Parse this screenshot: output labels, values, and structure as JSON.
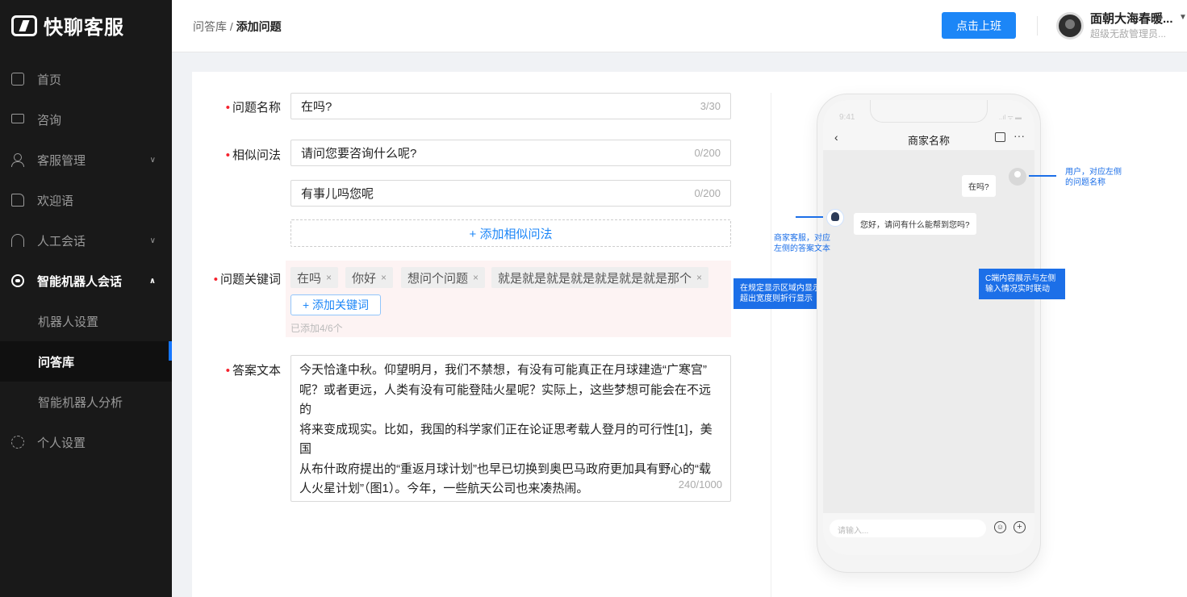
{
  "app": {
    "name": "快聊客服"
  },
  "sidebar": {
    "items": [
      {
        "label": "首页",
        "icon": "home-icon"
      },
      {
        "label": "咨询",
        "icon": "chat-icon"
      },
      {
        "label": "客服管理",
        "icon": "user-group-icon",
        "expandable": true
      },
      {
        "label": "欢迎语",
        "icon": "hand-icon"
      },
      {
        "label": "人工会话",
        "icon": "headset-icon",
        "expandable": true
      },
      {
        "label": "智能机器人会话",
        "icon": "robot-icon",
        "expanded": true
      },
      {
        "label": "个人设置",
        "icon": "gear-icon"
      }
    ],
    "subitems": [
      "机器人设置",
      "问答库",
      "智能机器人分析"
    ],
    "active_sub": "问答库",
    "accent": "#1677ff"
  },
  "header": {
    "breadcrumb_parent": "问答库",
    "breadcrumb_sep": " / ",
    "breadcrumb_current": "添加问题",
    "onduty_label": "点击上班",
    "user_name": "面朝大海春暖...",
    "user_role": "超级无敌管理员..."
  },
  "form": {
    "req_mark": "•",
    "question_label": "问题名称",
    "question_value": "在吗?",
    "question_count": "3/30",
    "similar_label": "相似问法",
    "similar": [
      {
        "value": "请问您要咨询什么呢?",
        "count": "0/200"
      },
      {
        "value": "有事儿吗您呢",
        "count": "0/200"
      }
    ],
    "add_similar": "+ 添加相似问法",
    "keywords_label": "问题关键词",
    "keywords": [
      "在吗",
      "你好",
      "想问个问题",
      "就是就是就是就是就是就是就是那个"
    ],
    "tag_close": "×",
    "add_keyword": "+ 添加关键词",
    "keyword_count": "已添加4/6个",
    "answer_label": "答案文本",
    "answer_lines": [
      "今天恰逢中秋。仰望明月，我们不禁想，有没有可能真正在月球建造“广寒宫”",
      "呢？或者更远，人类有没有可能登陆火星呢？实际上，这些梦想可能会在不远的",
      "将来变成现实。比如，我国的科学家们正在论证思考载人登月的可行性[1]，美国",
      "从布什政府提出的“重返月球计划”也早已切换到奥巴马政府更加具有野心的“载",
      "人火星计划”（图1）。今年，一些航天公司也来凑热闹。"
    ],
    "answer_count": "240/1000"
  },
  "annotations": {
    "keyword_note": [
      "在规定显示区域内显示，",
      "超出宽度则折行显示"
    ],
    "bot_note": [
      "商家客服，对应",
      "左侧的答案文本"
    ],
    "user_note": [
      "用户，对应左侧",
      "的问题名称"
    ],
    "sync_note": [
      "C端内容展示与左侧",
      "输入情况实时联动"
    ],
    "color": "#1c6fe8"
  },
  "phone": {
    "time": "9:41",
    "status": "..ıl ᯤ ▬",
    "title": "商家名称",
    "back": "‹",
    "more": "···",
    "user_msg": "在吗?",
    "bot_msg": "您好，请问有什么能帮到您吗?",
    "input_placeholder": "请输入...",
    "emoji": "☺",
    "plus": "+"
  }
}
